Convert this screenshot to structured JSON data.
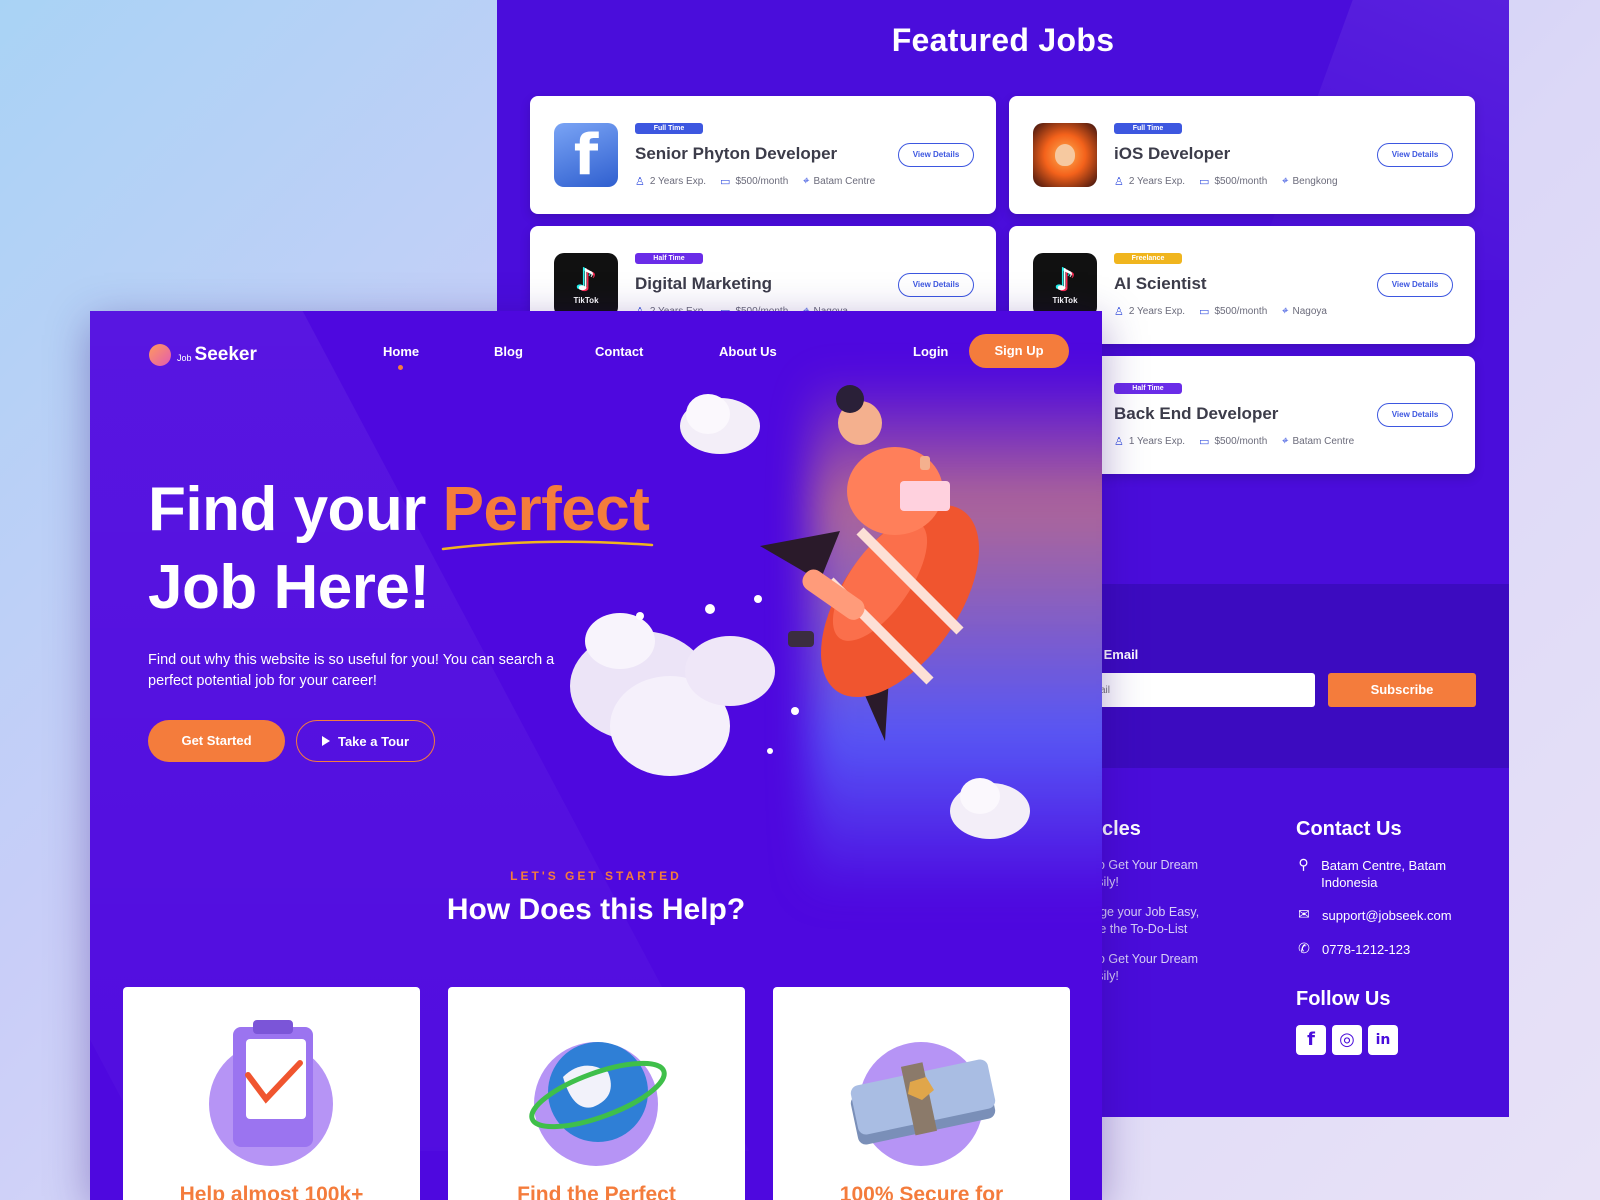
{
  "back_page": {
    "featured_title": "Featured Jobs",
    "jobs": [
      {
        "badge": "Full Time",
        "title": "Senior Phyton Developer",
        "exp": "2 Years Exp.",
        "salary": "$500/month",
        "location": "Batam Centre",
        "action": "View Details",
        "logo": "facebook-logo"
      },
      {
        "badge": "Full Time",
        "title": "iOS Developer",
        "exp": "2 Years Exp.",
        "salary": "$500/month",
        "location": "Bengkong",
        "action": "View Details",
        "logo": "apple-logo"
      },
      {
        "badge": "Half Time",
        "title": "Digital Marketing",
        "exp": "2 Years Exp.",
        "salary": "$500/month",
        "location": "Nagoya",
        "action": "View Details",
        "logo": "tiktok-logo"
      },
      {
        "badge": "Freelance",
        "title": "AI Scientist",
        "exp": "2 Years Exp.",
        "salary": "$500/month",
        "location": "Nagoya",
        "action": "View Details",
        "logo": "tiktok-logo"
      },
      {
        "badge": "Half Time",
        "title": "Back End Developer",
        "exp": "1 Years Exp.",
        "salary": "$500/month",
        "location": "Batam Centre",
        "action": "View Details",
        "logo": ""
      }
    ],
    "tiktok_label": "TikTok",
    "newsletter": {
      "label": "ur Email",
      "placeholder": "Email",
      "button": "Subscribe"
    },
    "footer": {
      "articles_title": "rticles",
      "articles": [
        "w to Get Your Dream\nEasily!",
        "range your Job Easy,\neate the To-Do-List",
        "w to Get Your Dream\nEasily!"
      ],
      "contact_title": "Contact Us",
      "address": "Batam Centre, Batam Indonesia",
      "email": "support@jobseek.com",
      "phone": "0778-1212-123",
      "follow_title": "Follow Us"
    }
  },
  "front_page": {
    "brand_small": "Job",
    "brand_big": "Seeker",
    "nav": [
      "Home",
      "Blog",
      "Contact",
      "About Us"
    ],
    "active_nav": "Home",
    "login": "Login",
    "signup": "Sign Up",
    "hero_line1": "Find your ",
    "hero_highlight": "Perfect",
    "hero_line2": "Job Here!",
    "hero_text": "Find out why this website is so useful for you! You can search a perfect potential job for your career!",
    "cta_primary": "Get Started",
    "cta_secondary": "Take a Tour",
    "eyebrow": "LET'S GET STARTED",
    "section_title": "How Does this Help?",
    "features": [
      "Help almost 100k+",
      "Find the Perfect",
      "100% Secure for"
    ]
  },
  "colors": {
    "brand_purple": "#4e08df",
    "accent_orange": "#f47c3c",
    "badge_blue": "#3d57e0",
    "badge_yellow": "#f0b51e"
  }
}
